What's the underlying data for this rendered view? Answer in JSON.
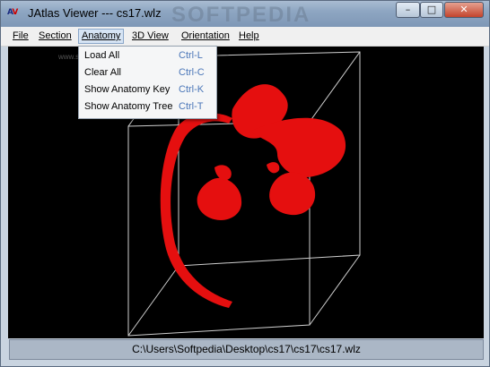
{
  "window": {
    "title": "JAtlas Viewer --- cs17.wlz",
    "icon_text": "AV",
    "watermark": "SOFTPEDIA",
    "controls": {
      "minimize": "–",
      "maximize": "□",
      "close": "✕"
    }
  },
  "menubar": {
    "items": [
      {
        "label": "File"
      },
      {
        "label": "Section"
      },
      {
        "label": "Anatomy"
      },
      {
        "label": "3D View"
      },
      {
        "label": "Orientation"
      },
      {
        "label": "Help"
      }
    ]
  },
  "anatomy_menu": {
    "items": [
      {
        "label": "Load All",
        "accel": "Ctrl-L"
      },
      {
        "label": "Clear All",
        "accel": "Ctrl-C"
      },
      {
        "label": "Show Anatomy Key",
        "accel": "Ctrl-K"
      },
      {
        "label": "Show Anatomy Tree",
        "accel": "Ctrl-T"
      }
    ]
  },
  "canvas": {
    "watermark_url": "www.softpedia.com",
    "model_color": "#e50f0f"
  },
  "status": {
    "path": "C:\\Users\\Softpedia\\Desktop\\cs17\\cs17\\cs17.wlz"
  }
}
